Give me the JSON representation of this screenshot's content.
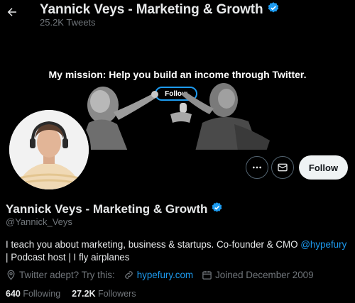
{
  "header": {
    "title": "Yannick Veys - Marketing & Growth",
    "tweets_count": "25.2K Tweets"
  },
  "banner": {
    "mission": "My mission:  Help you build an income through Twitter.",
    "follow_label": "Follow"
  },
  "actions": {
    "follow_label": "Follow"
  },
  "profile": {
    "name": "Yannick Veys - Marketing & Growth",
    "handle": "@Yannick_Veys",
    "bio_part1": "I teach you about marketing, business & startups. Co-founder & CMO ",
    "bio_mention": "@hypefury",
    "bio_part2": " | Podcast host | I fly airplanes",
    "location": "Twitter adept? Try this:",
    "website": "hypefury.com",
    "joined": "Joined December 2009"
  },
  "stats": {
    "following_count": "640",
    "following_label": "Following",
    "followers_count": "27.2K",
    "followers_label": "Followers"
  },
  "colors": {
    "accent": "#1d9bf0",
    "background": "#000000",
    "muted": "#71767b"
  }
}
